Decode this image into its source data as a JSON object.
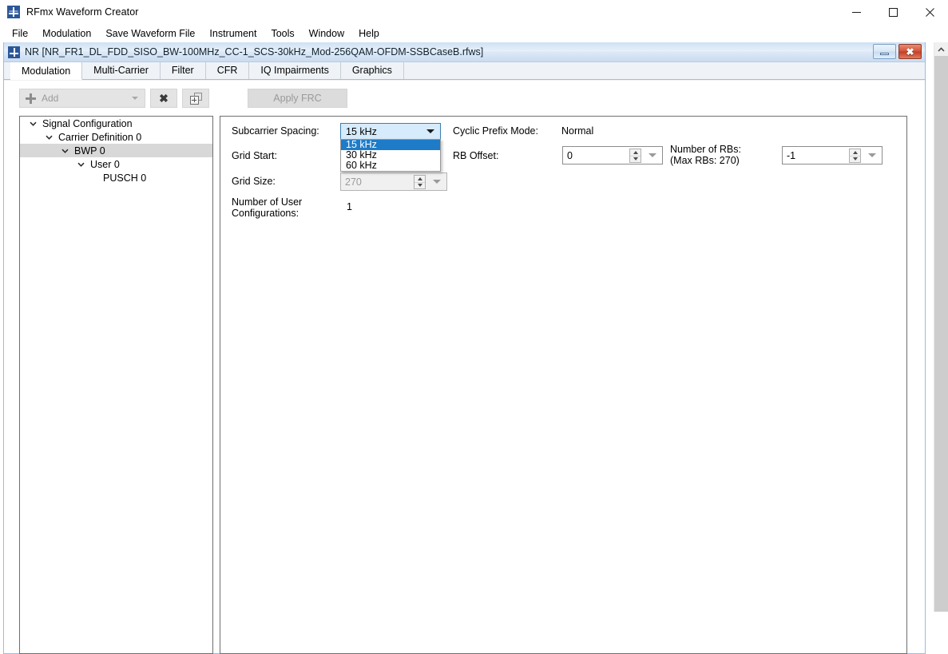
{
  "app": {
    "title": "RFmx Waveform Creator",
    "icon": "waveform-app-icon",
    "window_controls": {
      "minimize": "minimize-icon",
      "maximize": "maximize-icon",
      "close": "close-icon"
    }
  },
  "menu": {
    "items": [
      {
        "label": "File"
      },
      {
        "label": "Modulation"
      },
      {
        "label": "Save Waveform File"
      },
      {
        "label": "Instrument"
      },
      {
        "label": "Tools"
      },
      {
        "label": "Window"
      },
      {
        "label": "Help"
      }
    ]
  },
  "child_window": {
    "title": "NR [NR_FR1_DL_FDD_SISO_BW-100MHz_CC-1_SCS-30kHz_Mod-256QAM-OFDM-SSBCaseB.rfws]",
    "icon": "waveform-app-icon",
    "minimize_label": "minimize-icon",
    "close_label": "✖"
  },
  "tabs": [
    {
      "label": "Modulation",
      "active": true
    },
    {
      "label": "Multi-Carrier",
      "active": false
    },
    {
      "label": "Filter",
      "active": false
    },
    {
      "label": "CFR",
      "active": false
    },
    {
      "label": "IQ Impairments",
      "active": false
    },
    {
      "label": "Graphics",
      "active": false
    }
  ],
  "toolbar": {
    "add_label": "Add",
    "add_icon": "plus-icon",
    "add_dropdown_icon": "chevron-down-icon",
    "delete_icon": "✖",
    "duplicate_icon": "duplicate-icon",
    "apply_frc_label": "Apply FRC",
    "apply_frc_enabled": false
  },
  "tree": {
    "nodes": [
      {
        "label": "Signal Configuration",
        "depth": 0,
        "expander": "chevron-down-icon",
        "selected": false
      },
      {
        "label": "Carrier Definition 0",
        "depth": 1,
        "expander": "chevron-down-icon",
        "selected": false
      },
      {
        "label": "BWP 0",
        "depth": 2,
        "expander": "chevron-down-icon",
        "selected": true
      },
      {
        "label": "User 0",
        "depth": 3,
        "expander": "chevron-down-icon",
        "selected": false
      },
      {
        "label": "PUSCH 0",
        "depth": 4,
        "expander": "none",
        "selected": false
      }
    ]
  },
  "form": {
    "subcarrier_spacing": {
      "label": "Subcarrier Spacing:",
      "value": "15 kHz",
      "open": true,
      "options": [
        {
          "label": "15 kHz",
          "selected": true
        },
        {
          "label": "30 kHz",
          "selected": false
        },
        {
          "label": "60 kHz",
          "selected": false
        }
      ]
    },
    "grid_start": {
      "label": "Grid Start:"
    },
    "grid_size": {
      "label": "Grid Size:",
      "value": "270",
      "disabled": true
    },
    "number_of_user_configurations": {
      "label_line1": "Number of User",
      "label_line2": "Configurations:",
      "value": "1"
    },
    "cyclic_prefix_mode": {
      "label": "Cyclic Prefix Mode:",
      "value": "Normal"
    },
    "rb_offset": {
      "label": "RB Offset:",
      "value": "0"
    },
    "number_of_rbs": {
      "label_line1": "Number of RBs:",
      "label_line2": "(Max RBs: 270)",
      "value": "-1"
    }
  },
  "scrollbar": {
    "up_arrow": "chevron-up-icon"
  },
  "colors": {
    "accent_blue": "#1d7bc8",
    "combo_border": "#3c7fb1",
    "combo_fill": "#d6ebfb",
    "tree_selection": "#d8d8d8",
    "close_red": "#c23f26"
  }
}
